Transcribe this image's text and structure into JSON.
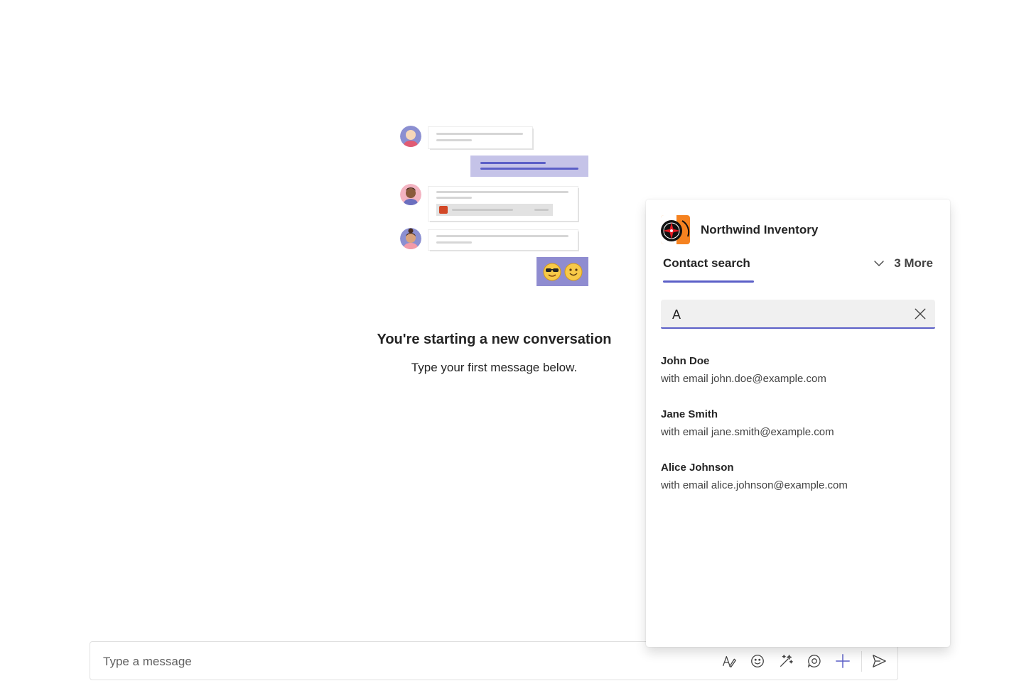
{
  "empty_state": {
    "title": "You're starting a new conversation",
    "subtitle": "Type your first message below."
  },
  "compose": {
    "placeholder": "Type a message",
    "tools": [
      "format-icon",
      "emoji-icon",
      "copilot-sparkle-icon",
      "loop-icon",
      "add-icon",
      "send-icon"
    ]
  },
  "popup": {
    "app_name": "Northwind Inventory",
    "active_tab": "Contact search",
    "more_label": "3 More",
    "search_value": "A",
    "results": [
      {
        "name": "John Doe",
        "email": "with email john.doe@example.com"
      },
      {
        "name": "Jane Smith",
        "email": "with email jane.smith@example.com"
      },
      {
        "name": "Alice Johnson",
        "email": "with email alice.johnson@example.com"
      }
    ]
  },
  "colors": {
    "accent": "#5b5fc7",
    "self_bubble": "#c5c3e8",
    "emoji_box": "#8f8cd0"
  }
}
